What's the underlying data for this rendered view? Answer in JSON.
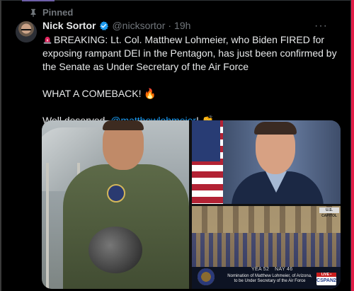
{
  "pinned_label": "Pinned",
  "author": {
    "name": "Nick Sortor",
    "handle": "@nicksortor",
    "dot": "·",
    "time": "19h",
    "verified_color": "#1d9bf0"
  },
  "more_label": "···",
  "post": {
    "line1": "BREAKING: Lt. Col. Matthew Lohmeier, who Biden FIRED for exposing rampant DEI in the Pentagon, has just been confirmed by the Senate as Under Secretary of the Air Force",
    "line2": "WHAT A COMEBACK! 🔥",
    "line3_prefix": "Well deserved, ",
    "mention": "@matthewlohmeier",
    "line3_suffix": "! 👏"
  },
  "media": {
    "senate_tag": "U.S. CAPITOL",
    "yea_label": "YEA 52",
    "nay_label": "NAY 46",
    "caption": "Nomination of Matthew Lohmeier, of Arizona, to be Under Secretary of the Air Force",
    "live_label": "LIVE • SENATE",
    "network_label": "CSPAN2"
  },
  "colors": {
    "background": "#000000",
    "text": "#e7e9ea",
    "muted": "#71767b",
    "link": "#1d9bf0"
  },
  "icons": {
    "pin": "pin-icon",
    "verified": "verified-badge-icon",
    "siren": "siren-emoji-icon",
    "more": "more-options-icon"
  }
}
